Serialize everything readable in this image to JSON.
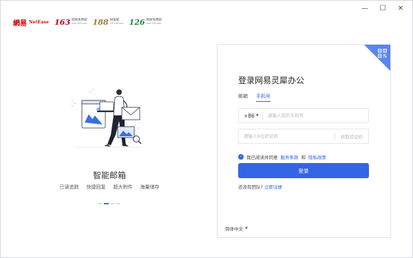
{
  "brand": {
    "netease_cn": "網易",
    "netease_en": "NetEase",
    "logos": [
      {
        "num": "163",
        "cn": "网易免费邮",
        "en": "mail.163.com"
      },
      {
        "num": "188",
        "cn": "财富邮",
        "en": "VIP 188.com"
      },
      {
        "num": "126",
        "cn": "网易免费邮",
        "en": "mail.126.com"
      }
    ]
  },
  "window_controls": {
    "minimize": "—",
    "maximize": "☐",
    "close": "✕"
  },
  "left": {
    "slogan": "智能邮箱",
    "features": [
      "已读追踪",
      "快捷回复",
      "超大附件",
      "海量储存"
    ]
  },
  "login": {
    "title": "登录网易灵犀办公",
    "tabs": [
      "邮箱",
      "手机号"
    ],
    "country_code": "+86",
    "phone_placeholder": "请输入您的手机号",
    "code_placeholder": "请输入6位验证码",
    "get_code": "获取验证码",
    "agree_prefix": "我已阅读并同意",
    "terms": "服务条款",
    "and": "和",
    "privacy": "隐私政策",
    "login_button": "登录",
    "register_prefix": "还没有团队?",
    "register_link": "立即注册",
    "language": "简体中文"
  },
  "colors": {
    "accent": "#3366e6",
    "corner": "#5b84f0",
    "brand_red": "#d40000"
  }
}
